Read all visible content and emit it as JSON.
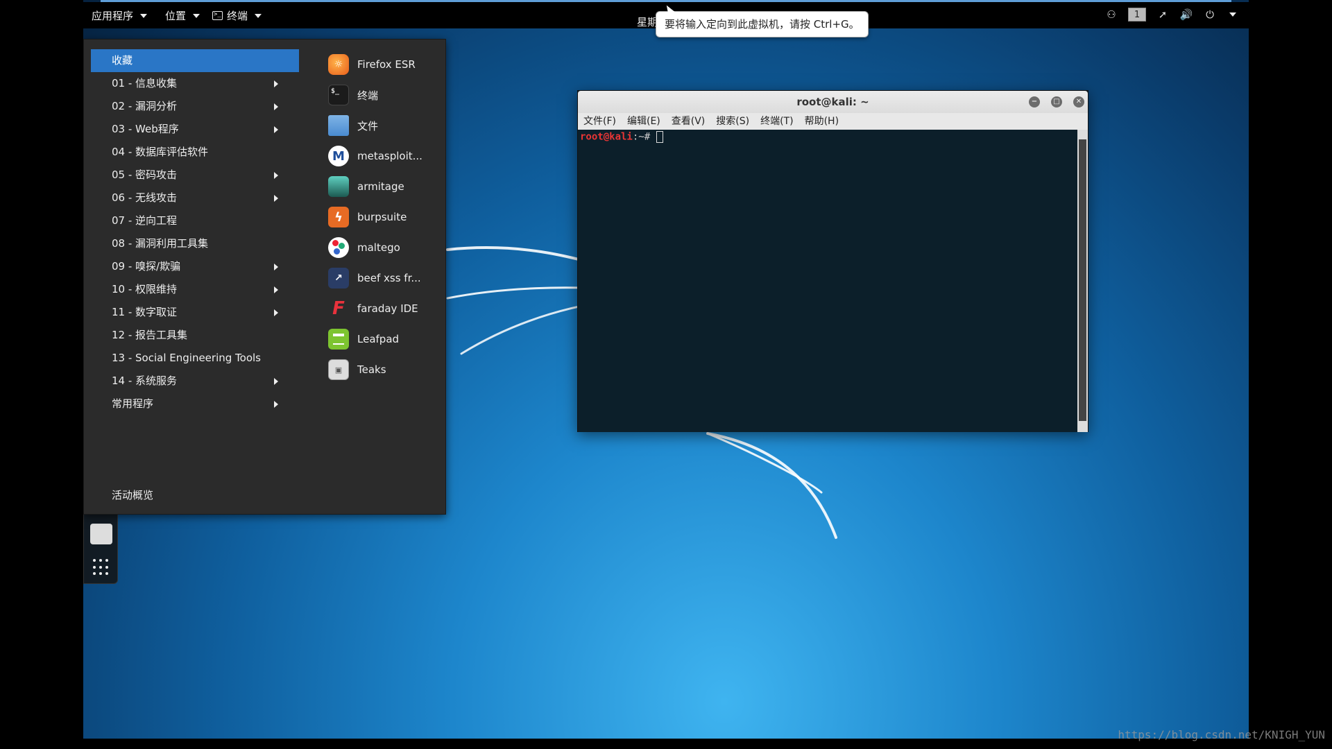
{
  "panel": {
    "apps_menu": "应用程序",
    "places_menu": "位置",
    "terminal_menu": "终端",
    "clock_partial": "星期",
    "workspace": "1"
  },
  "tooltip": {
    "text": "要将输入定向到此虚拟机，请按 Ctrl+G。"
  },
  "app_menu": {
    "categories": [
      {
        "label": "收藏",
        "has_submenu": false,
        "selected": true
      },
      {
        "label": "01 - 信息收集",
        "has_submenu": true
      },
      {
        "label": "02 - 漏洞分析",
        "has_submenu": true
      },
      {
        "label": "03 - Web程序",
        "has_submenu": true
      },
      {
        "label": "04 - 数据库评估软件",
        "has_submenu": false
      },
      {
        "label": "05 - 密码攻击",
        "has_submenu": true
      },
      {
        "label": "06 - 无线攻击",
        "has_submenu": true
      },
      {
        "label": "07 - 逆向工程",
        "has_submenu": false
      },
      {
        "label": "08 - 漏洞利用工具集",
        "has_submenu": false
      },
      {
        "label": "09 - 嗅探/欺骗",
        "has_submenu": true
      },
      {
        "label": "10 - 权限维持",
        "has_submenu": true
      },
      {
        "label": "11 - 数字取证",
        "has_submenu": true
      },
      {
        "label": "12 - 报告工具集",
        "has_submenu": false
      },
      {
        "label": "13 - Social Engineering Tools",
        "has_submenu": false
      },
      {
        "label": "14 - 系统服务",
        "has_submenu": true
      },
      {
        "label": "常用程序",
        "has_submenu": true
      }
    ],
    "activities": "活动概览",
    "favorites": [
      {
        "label": "Firefox ESR",
        "icon": "firefox-icon"
      },
      {
        "label": "终端",
        "icon": "terminal-icon"
      },
      {
        "label": "文件",
        "icon": "folder-icon"
      },
      {
        "label": "metasploit...",
        "icon": "metasploit-icon"
      },
      {
        "label": "armitage",
        "icon": "armitage-icon"
      },
      {
        "label": "burpsuite",
        "icon": "burpsuite-icon"
      },
      {
        "label": "maltego",
        "icon": "maltego-icon"
      },
      {
        "label": "beef xss fr...",
        "icon": "beef-icon"
      },
      {
        "label": "faraday IDE",
        "icon": "faraday-icon"
      },
      {
        "label": "Leafpad",
        "icon": "leafpad-icon"
      },
      {
        "label": "Teaks",
        "icon": "teaks-icon"
      }
    ]
  },
  "terminal": {
    "title": "root@kali: ~",
    "menus": [
      "文件(F)",
      "编辑(E)",
      "查看(V)",
      "搜索(S)",
      "终端(T)",
      "帮助(H)"
    ],
    "prompt_user": "root@kali",
    "prompt_rest": ":~# "
  },
  "watermark": "https://blog.csdn.net/KNIGH_YUN"
}
